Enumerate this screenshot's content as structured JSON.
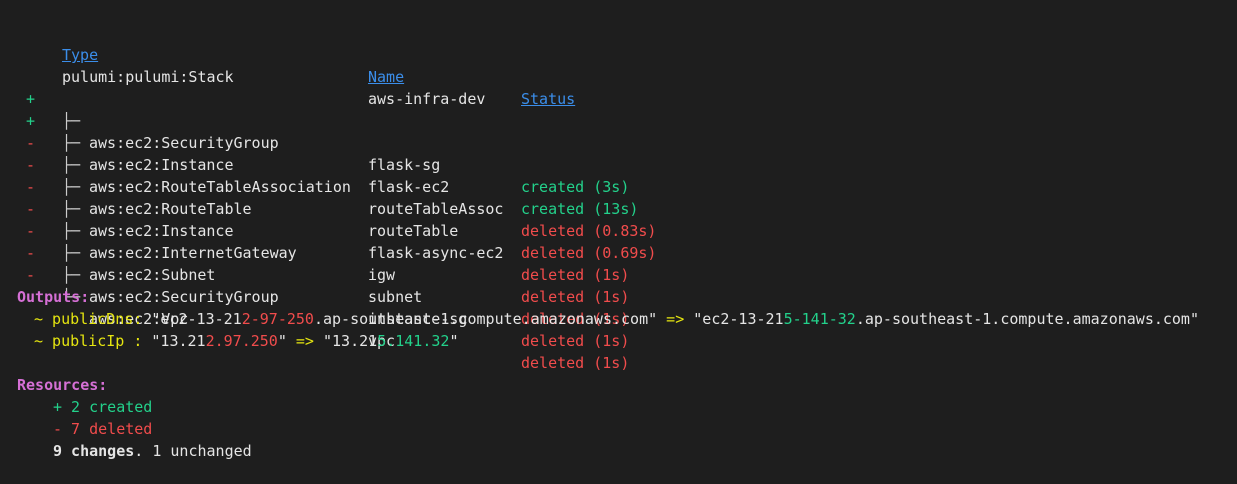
{
  "headers": {
    "type": "Type",
    "name": "Name",
    "status": "Status"
  },
  "stack": {
    "type": "pulumi:pulumi:Stack",
    "name": "aws-infra-dev"
  },
  "rows": [
    {
      "op": "+",
      "tree": "├─",
      "type": "aws:ec2:SecurityGroup",
      "name": "flask-sg",
      "status": "created (3s)",
      "kind": "created"
    },
    {
      "op": "+",
      "tree": "├─",
      "type": "aws:ec2:Instance",
      "name": "flask-ec2",
      "status": "created (13s)",
      "kind": "created"
    },
    {
      "op": "-",
      "tree": "├─",
      "type": "aws:ec2:RouteTableAssociation",
      "name": "routeTableAssoc",
      "status": "deleted (0.83s)",
      "kind": "deleted"
    },
    {
      "op": "-",
      "tree": "├─",
      "type": "aws:ec2:RouteTable",
      "name": "routeTable",
      "status": "deleted (0.69s)",
      "kind": "deleted"
    },
    {
      "op": "-",
      "tree": "├─",
      "type": "aws:ec2:Instance",
      "name": "flask-async-ec2",
      "status": "deleted (1s)",
      "kind": "deleted"
    },
    {
      "op": "-",
      "tree": "├─",
      "type": "aws:ec2:InternetGateway",
      "name": "igw",
      "status": "deleted (1s)",
      "kind": "deleted"
    },
    {
      "op": "-",
      "tree": "├─",
      "type": "aws:ec2:Subnet",
      "name": "subnet",
      "status": "deleted (1s)",
      "kind": "deleted"
    },
    {
      "op": "-",
      "tree": "├─",
      "type": "aws:ec2:SecurityGroup",
      "name": "instance-sg",
      "status": "deleted (1s)",
      "kind": "deleted"
    },
    {
      "op": "-",
      "tree": "└─",
      "type": "aws:ec2:Vpc",
      "name": "vpc",
      "status": "deleted (1s)",
      "kind": "deleted"
    }
  ],
  "outputs": {
    "title": "Outputs:",
    "dns": {
      "prefix": "~ publicDns: ",
      "old_a": "\"ec2-13-21",
      "old_b": "2-97-250",
      "old_c": ".ap-southeast-1.compute.amazonaws.com\"",
      "arrow": " => ",
      "new_a": "\"ec2-13-21",
      "new_b": "5-141-32",
      "new_c": ".ap-southeast-1.compute.amazonaws.com\""
    },
    "ip": {
      "prefix": "~ publicIp : ",
      "old_a": "\"13.21",
      "old_b": "2.97.250",
      "old_c": "\"",
      "arrow": " => ",
      "new_a": "\"13.21",
      "new_b": "5.141.32",
      "new_c": "\""
    }
  },
  "resources": {
    "title": "Resources:",
    "created": "+ 2 created",
    "deleted": "- 7 deleted",
    "changes_bold": "9 changes",
    "changes_rest": ". 1 unchanged"
  },
  "colors": {
    "background": "#1e1e1e",
    "header": "#3b8eea",
    "created": "#23d18b",
    "deleted": "#f14c4c",
    "changed": "#e5e510",
    "section": "#d670d6"
  }
}
